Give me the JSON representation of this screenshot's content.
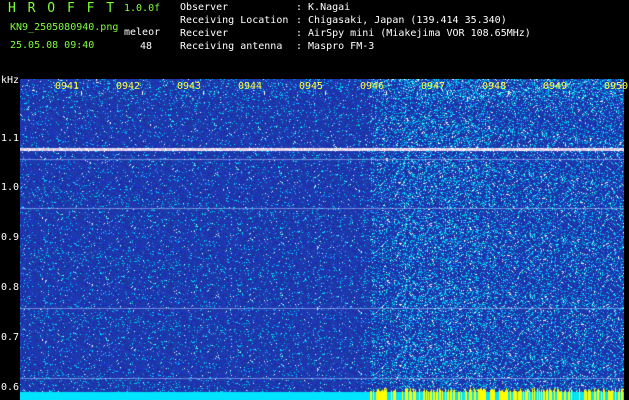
{
  "header": {
    "logo": "H R O F F T",
    "version": "1.0.0f",
    "filename": "KN9_2505080940.png",
    "datetime": "25.05.08 09:40",
    "mode_label": "meleor",
    "mode_value": "48"
  },
  "info": {
    "rows": [
      {
        "label": "Observer",
        "value": ": K.Nagai"
      },
      {
        "label": "Receiving Location",
        "value": ": Chigasaki, Japan (139.414 35.340)"
      },
      {
        "label": "Receiver",
        "value": ": AirSpy mini (Miakejima VOR 108.65MHz)"
      },
      {
        "label": "Receiving antenna",
        "value": ": Maspro FM-3"
      }
    ]
  },
  "spectrogram": {
    "unit_label": "kHz",
    "time_ticks": [
      "0941",
      "0942",
      "0943",
      "0944",
      "0945",
      "0946",
      "0947",
      "0948",
      "0949",
      "0950"
    ],
    "freq_ticks": [
      1.1,
      1.0,
      0.9,
      0.8,
      0.7,
      0.6
    ],
    "freq_range": [
      0.575,
      1.22
    ],
    "time_range_minutes": [
      0,
      10
    ],
    "carrier_khz": 1.08,
    "interference_lines_khz": [
      0.62,
      0.76,
      0.96,
      1.06
    ],
    "colors": {
      "background": "#1a2fa8",
      "noise": "#00c8ff",
      "signal": "#ffffff",
      "strip": "#00e5ff",
      "strip_hot": "#ffff00"
    }
  }
}
